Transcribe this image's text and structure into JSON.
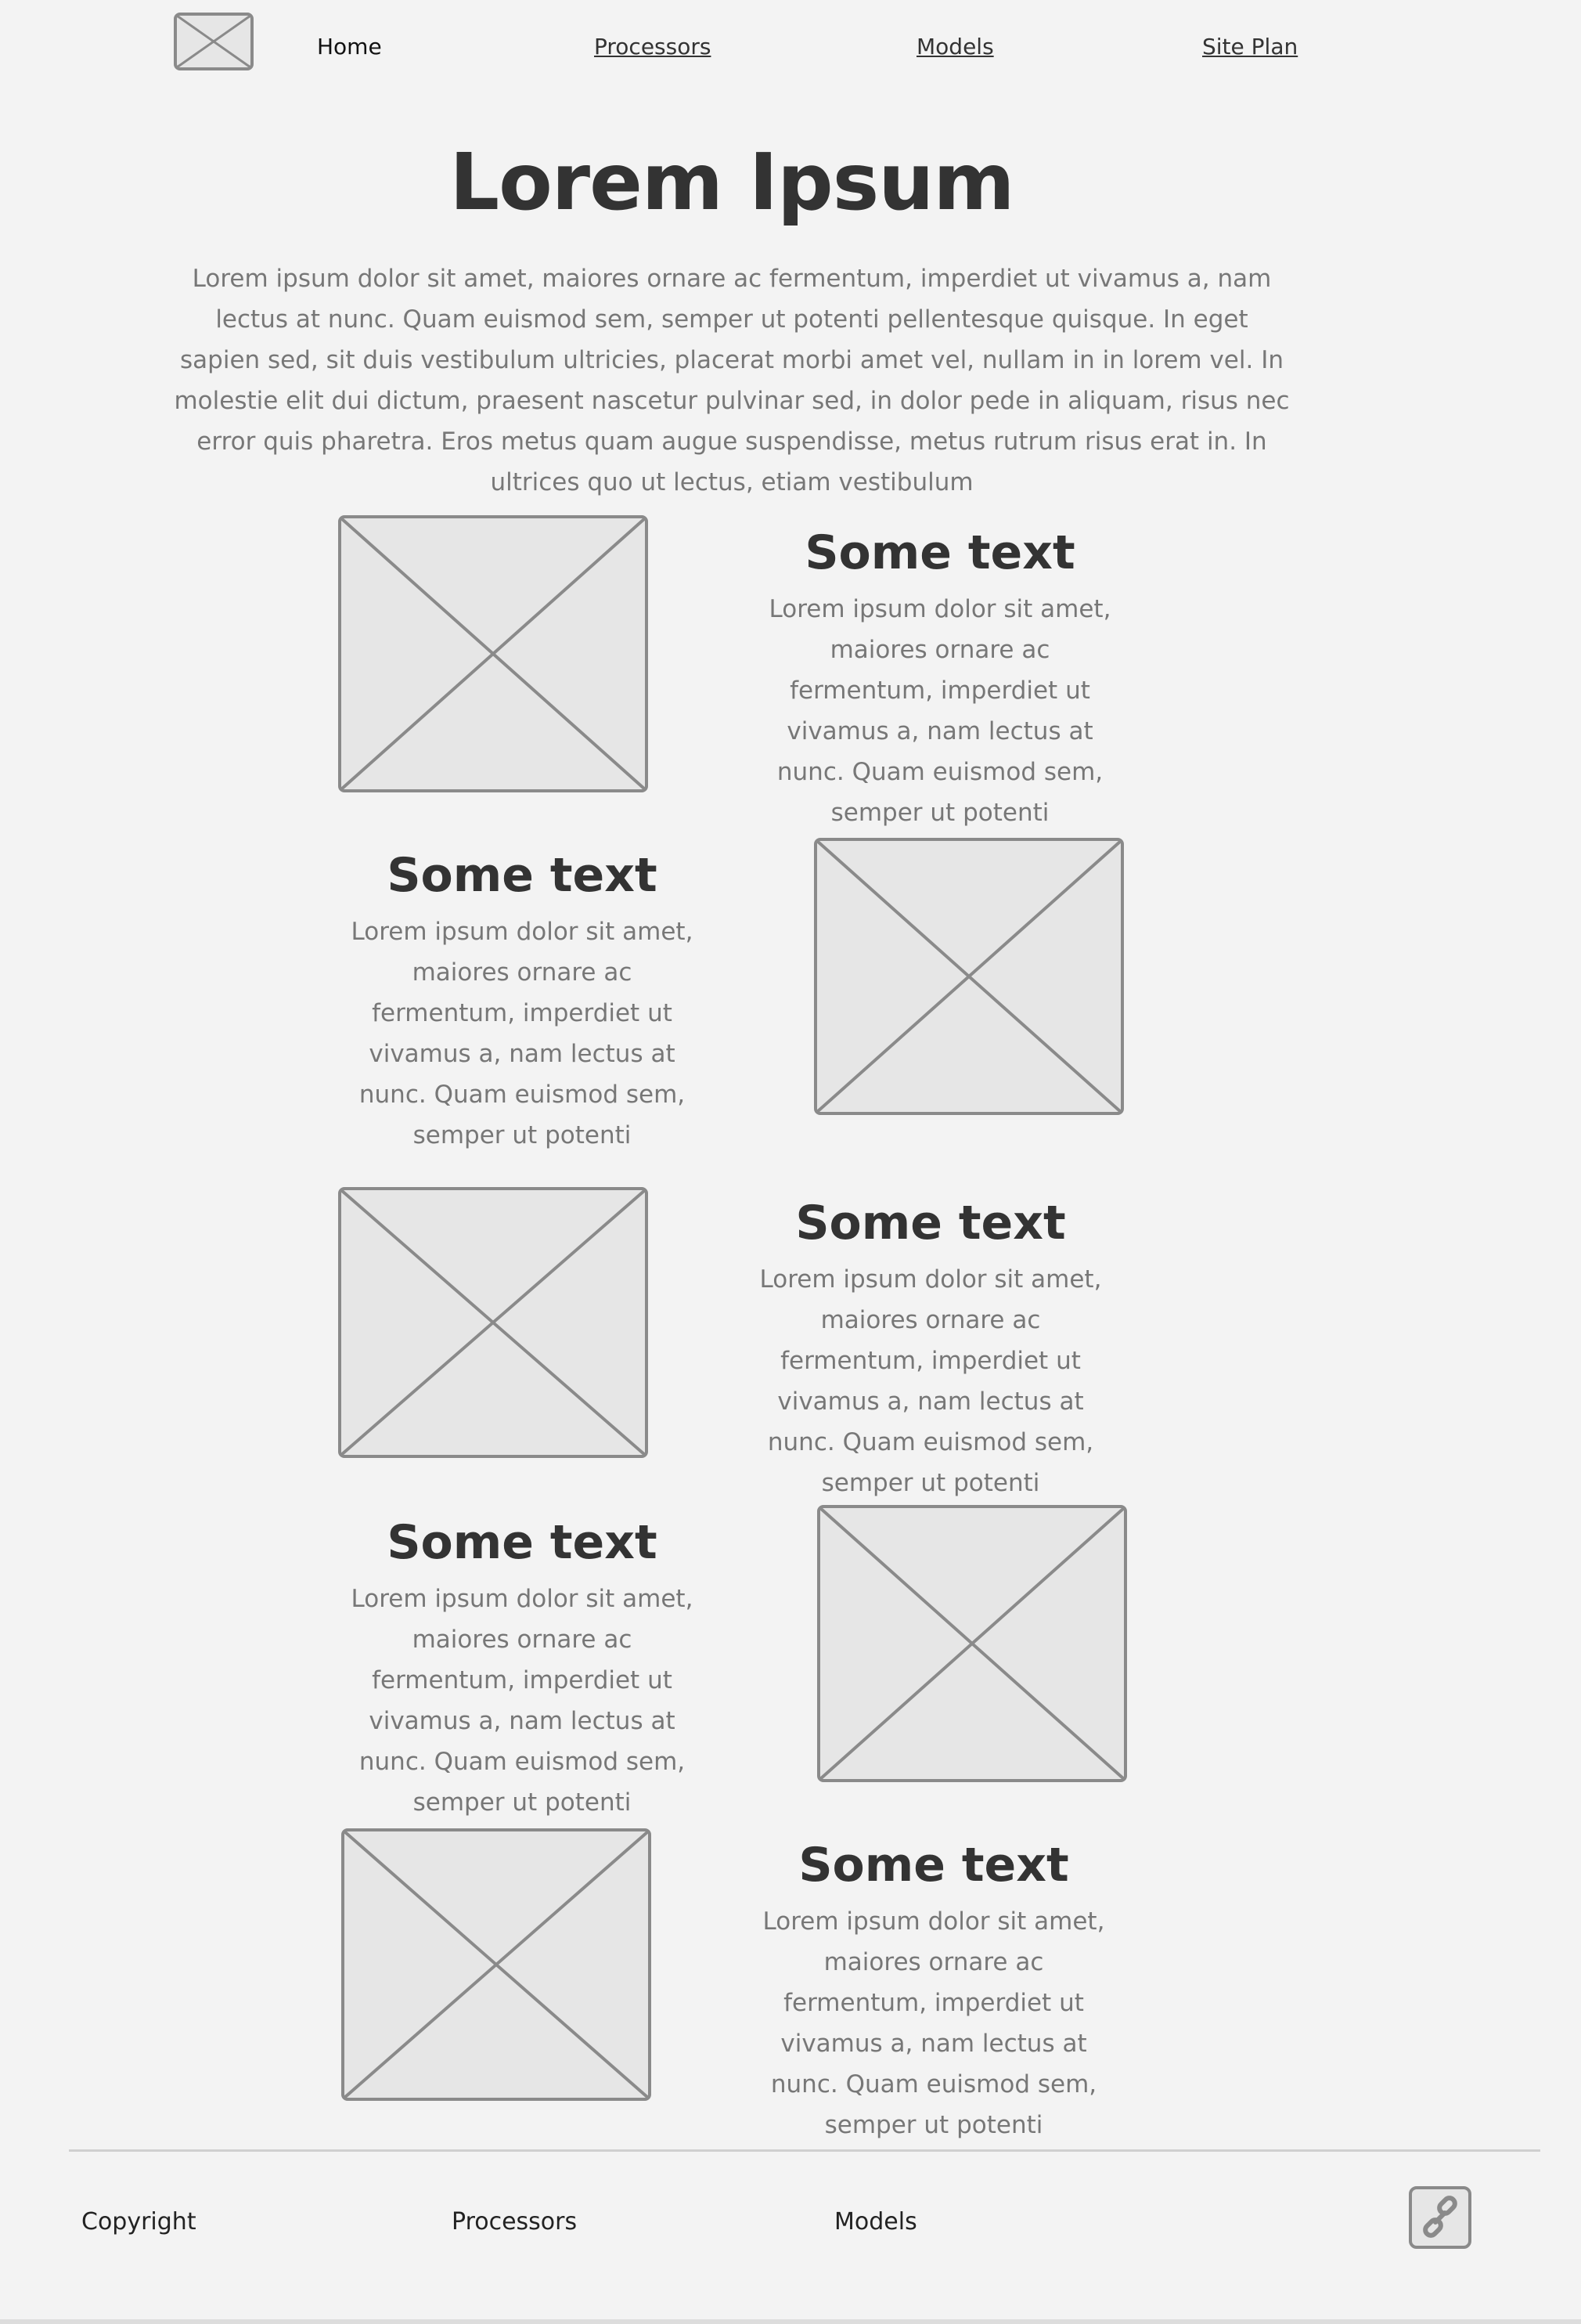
{
  "nav": {
    "logo_icon": "image-placeholder-icon",
    "items": [
      {
        "label": "Home"
      },
      {
        "label": "Processors"
      },
      {
        "label": "Models"
      },
      {
        "label": "Site Plan"
      }
    ]
  },
  "hero": {
    "title": "Lorem Ipsum",
    "text": "Lorem ipsum dolor sit amet, maiores ornare ac fermentum, imperdiet ut vivamus a, nam lectus at nunc. Quam euismod sem, semper ut potenti pellentesque quisque. In eget sapien sed, sit duis vestibulum ultricies, placerat morbi amet vel, nullam in in lorem vel. In molestie elit dui dictum, praesent nascetur pulvinar sed, in dolor pede in aliquam, risus nec error quis pharetra. Eros metus quam augue suspendisse, metus rutrum risus erat in.  In ultrices quo ut lectus, etiam vestibulum"
  },
  "sections": [
    {
      "heading": "Some text",
      "text": "Lorem ipsum dolor sit amet, maiores ornare ac fermentum, imperdiet ut vivamus a, nam lectus at nunc. Quam euismod sem, semper ut potenti"
    },
    {
      "heading": "Some text",
      "text": "Lorem ipsum dolor sit amet, maiores ornare ac fermentum, imperdiet ut vivamus a, nam lectus at nunc. Quam euismod sem, semper ut potenti"
    },
    {
      "heading": "Some text",
      "text": "Lorem ipsum dolor sit amet, maiores ornare ac fermentum, imperdiet ut vivamus a, nam lectus at nunc. Quam euismod sem, semper ut potenti"
    },
    {
      "heading": "Some text",
      "text": "Lorem ipsum dolor sit amet, maiores ornare ac fermentum, imperdiet ut vivamus a, nam lectus at nunc. Quam euismod sem, semper ut potenti"
    },
    {
      "heading": "Some text",
      "text": "Lorem ipsum dolor sit amet, maiores ornare ac fermentum, imperdiet ut vivamus a, nam lectus at nunc. Quam euismod sem, semper ut potenti"
    }
  ],
  "footer": {
    "items": [
      {
        "label": "Copyright"
      },
      {
        "label": "Processors"
      },
      {
        "label": "Models"
      }
    ],
    "link_icon": "link-icon"
  },
  "colors": {
    "background": "#f3f3f3",
    "placeholder_fill": "#e6e6e6",
    "placeholder_stroke": "#8a8a8a",
    "heading": "#333333",
    "body_text": "#777777"
  }
}
